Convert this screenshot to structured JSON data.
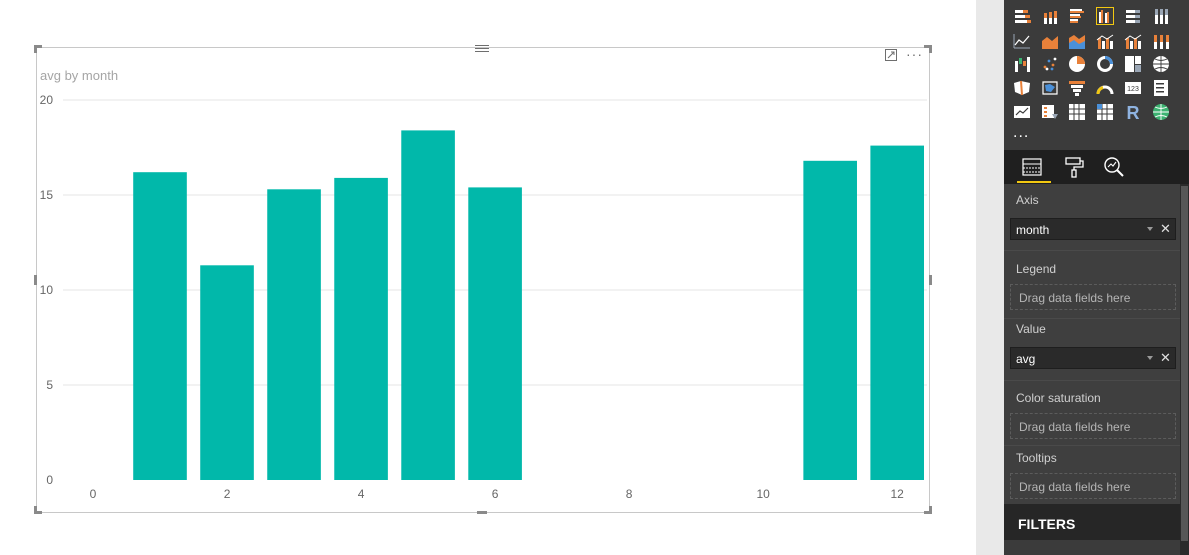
{
  "chart_data": {
    "type": "bar",
    "title": "avg by month",
    "xlabel": "",
    "ylabel": "",
    "x": [
      1,
      2,
      3,
      4,
      5,
      6,
      11,
      12
    ],
    "values": [
      16.2,
      11.3,
      15.3,
      15.9,
      18.4,
      15.4,
      16.8,
      17.6
    ],
    "xlim": [
      0,
      12.4
    ],
    "ylim": [
      0,
      20
    ],
    "x_ticks": [
      "0",
      "2",
      "4",
      "6",
      "8",
      "10",
      "12"
    ],
    "y_ticks": [
      "0",
      "5",
      "10",
      "15",
      "20"
    ],
    "bar_color": "#01b8aa",
    "grid": true,
    "legend": "none"
  },
  "fields_pane": {
    "wells": {
      "axis": {
        "label": "Axis",
        "field": "month"
      },
      "legend": {
        "label": "Legend",
        "placeholder": "Drag data fields here"
      },
      "value": {
        "label": "Value",
        "field": "avg"
      },
      "color_saturation": {
        "label": "Color saturation",
        "placeholder": "Drag data fields here"
      },
      "tooltips": {
        "label": "Tooltips",
        "placeholder": "Drag data fields here"
      }
    },
    "remove_glyph": "✕",
    "filters_label": "FILTERS",
    "tabs": [
      "fields-icon",
      "format-paint-roller-icon",
      "analytics-magnifier-icon"
    ]
  },
  "visualizations": {
    "more_label": "...",
    "icons": [
      "stacked-bar-icon",
      "stacked-column-icon",
      "clustered-bar-icon",
      "clustered-column-icon",
      "100-stacked-bar-icon",
      "100-stacked-column-icon",
      "line-chart-icon",
      "area-chart-icon",
      "stacked-area-icon",
      "line-clustered-column-icon",
      "line-stacked-column-icon",
      "ribbon-chart-icon",
      "waterfall-icon",
      "scatter-icon",
      "pie-icon",
      "donut-icon",
      "treemap-icon",
      "map-icon",
      "filled-map-icon",
      "shape-map-icon",
      "funnel-icon",
      "gauge-icon",
      "card-icon",
      "multirow-card-icon",
      "kpi-icon",
      "slicer-icon",
      "table-icon",
      "matrix-icon",
      "r-visual-icon",
      "globe-icon"
    ],
    "r_label": "R",
    "card_label": "123",
    "selected_icon": "clustered-column-icon",
    "accent": "#f2c811"
  }
}
